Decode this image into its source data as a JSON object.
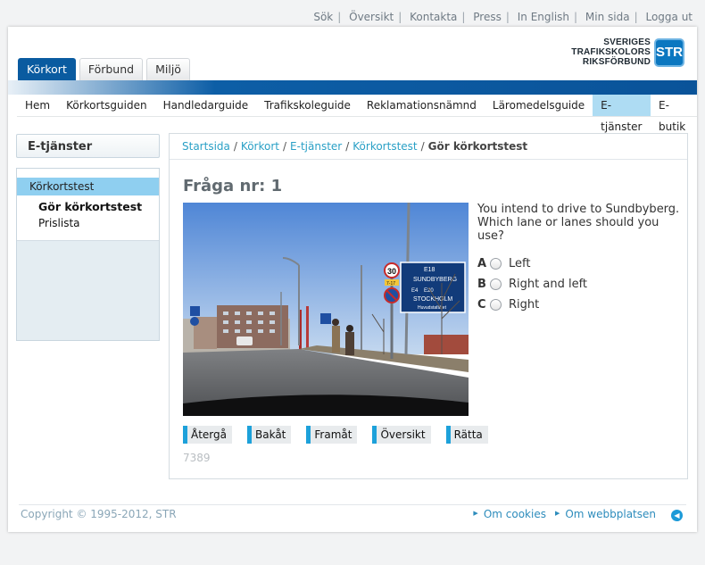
{
  "top_links": [
    "Sök",
    "Översikt",
    "Kontakta",
    "Press",
    "In English",
    "Min sida",
    "Logga ut"
  ],
  "logo": {
    "line1": "SVERIGES",
    "line2": "TRAFIKSKOLORS",
    "line3": "RIKSFÖRBUND",
    "badge": "STR",
    "color": "#0b77c0"
  },
  "tabs": [
    {
      "label": "Körkort",
      "active": true
    },
    {
      "label": "Förbund",
      "active": false
    },
    {
      "label": "Miljö",
      "active": false
    }
  ],
  "nav": [
    "Hem",
    "Körkortsguiden",
    "Handledarguide",
    "Trafikskoleguide",
    "Reklamationsnämnd",
    "Läromedelsguide",
    "E-tjänster",
    "E-butik"
  ],
  "nav_active": "E-tjänster",
  "sidebar": {
    "heading": "E-tjänster",
    "active_item": "Körkortstest",
    "sub_items": [
      {
        "label": "Gör körkortstest",
        "bold": true
      },
      {
        "label": "Prislista",
        "bold": false
      }
    ]
  },
  "breadcrumb": [
    "Startsida",
    "Körkort",
    "E-tjänster",
    "Körkortstest"
  ],
  "breadcrumb_current": "Gör körkortstest",
  "question": {
    "title": "Fråga nr: 1",
    "text": "You intend to drive to Sundbyberg. Which lane or lanes should you use?",
    "answers": [
      {
        "letter": "A",
        "label": "Left"
      },
      {
        "letter": "B",
        "label": "Right and left"
      },
      {
        "letter": "C",
        "label": "Right"
      }
    ],
    "id": "7389"
  },
  "photo_signs": {
    "speed": "30",
    "speed_time": "7-17",
    "road1": "E18",
    "dest1": "SUNDBYBERG",
    "road2": "E4",
    "road3": "E20",
    "dest2": "STOCKHOLM",
    "dest3": "Huvudstafältet"
  },
  "buttons": [
    "Återgå",
    "Bakåt",
    "Framåt",
    "Översikt",
    "Rätta"
  ],
  "footer": {
    "copyright": "Copyright © 1995-2012, STR",
    "links": [
      "Om cookies",
      "Om webbplatsen"
    ]
  },
  "colors": {
    "accent": "#1da1da",
    "nav_blue": "#0a5ba0",
    "highlight": "#aedcf3"
  }
}
